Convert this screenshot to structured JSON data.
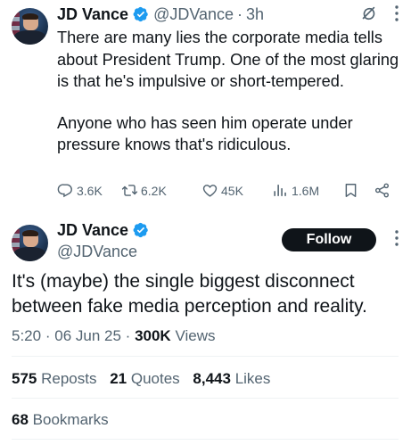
{
  "tweet1": {
    "author_name": "JD Vance",
    "handle": "@JDVance",
    "separator": "·",
    "time": "3h",
    "paragraphs": [
      "There are many lies the corporate media tells about President Trump. One of the most glaring is that he's impulsive or short-tempered.",
      "Anyone who has seen him operate under pressure knows that's ridiculous."
    ],
    "actions": {
      "replies": "3.6K",
      "reposts": "6.2K",
      "likes": "45K",
      "views": "1.6M"
    }
  },
  "tweet2": {
    "author_name": "JD Vance",
    "handle": "@JDVance",
    "follow_label": "Follow",
    "text": "It's (maybe) the single biggest disconnect between fake media perception and reality.",
    "time": "5:20",
    "date": "06 Jun 25",
    "separator": "·",
    "views_count": "300K",
    "views_label": "Views",
    "reposts_count": "575",
    "reposts_label": "Reposts",
    "quotes_count": "21",
    "quotes_label": "Quotes",
    "likes_count": "8,443",
    "likes_label": "Likes",
    "bookmarks_count": "68",
    "bookmarks_label": "Bookmarks"
  },
  "colors": {
    "text_primary": "#0f1419",
    "text_secondary": "#536471",
    "verified_blue": "#1d9bf0",
    "divider": "#eff3f4",
    "follow_bg": "#0f1419"
  },
  "icons": [
    "verified-badge-icon",
    "grok-icon",
    "more-icon",
    "reply-icon",
    "repost-icon",
    "like-icon",
    "views-icon",
    "bookmark-icon",
    "share-icon"
  ]
}
